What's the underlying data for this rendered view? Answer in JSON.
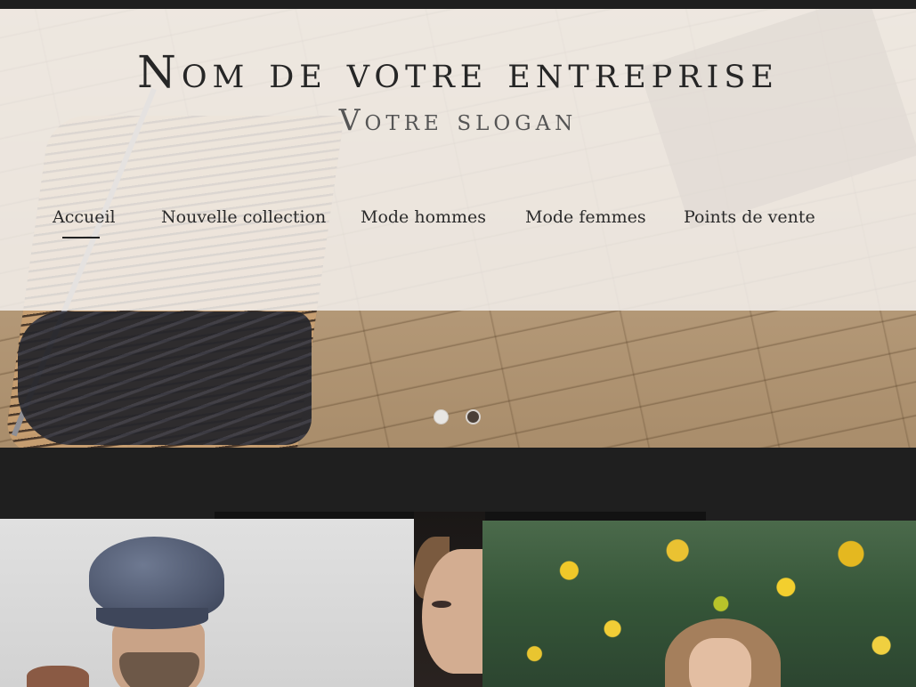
{
  "brand": {
    "title": "Nom de votre entreprise",
    "slogan": "Votre slogan"
  },
  "nav": {
    "items": [
      {
        "label": "Accueil",
        "active": true
      },
      {
        "label": "Nouvelle collection",
        "active": false
      },
      {
        "label": "Mode hommes",
        "active": false
      },
      {
        "label": "Mode femmes",
        "active": false
      },
      {
        "label": "Points de vente",
        "active": false
      }
    ]
  },
  "slider": {
    "slide_count": 2,
    "current_slide": 2
  },
  "colors": {
    "page_background": "#1f1f1f",
    "header_overlay": "#f3f0ec",
    "text_primary": "#262626",
    "text_secondary": "#555555",
    "active_dot": "#4a3f37",
    "inactive_dot": "#e8e6e3"
  },
  "images": {
    "hero": "clothing-rack-on-wooden-floor",
    "gallery": [
      "man-in-flat-cap",
      "woman-portrait-dark",
      "woman-in-yellow-foliage"
    ]
  }
}
